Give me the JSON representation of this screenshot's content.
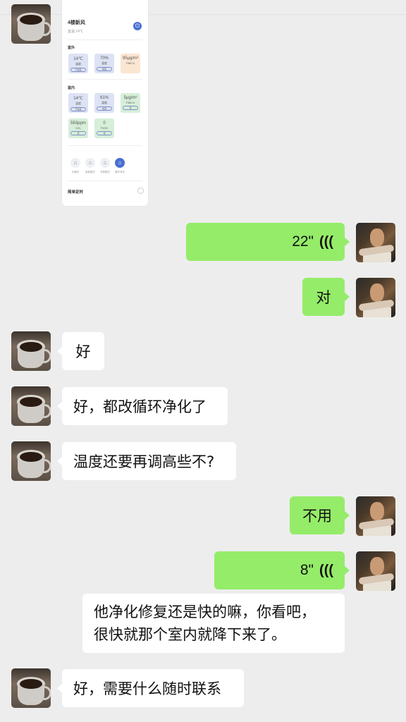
{
  "card": {
    "device_title": "4楼新风",
    "device_sub": "室温 14℃",
    "outdoor_label": "室外",
    "indoor_label": "室内",
    "outdoor_tiles": [
      {
        "value": "14℃",
        "label": "温度",
        "btn": "不适宜"
      },
      {
        "value": "70%",
        "label": "湿度",
        "btn": "适宜"
      },
      {
        "value": "95μg/m³",
        "label": "PM2.5",
        "btn": ""
      }
    ],
    "indoor_tiles": [
      {
        "value": "14℃",
        "label": "温度",
        "btn": "不适宜"
      },
      {
        "value": "61%",
        "label": "湿度",
        "btn": "适宜"
      },
      {
        "value": "5μg/m³",
        "label": "PM2.5",
        "btn": "优"
      },
      {
        "value": "563ppm",
        "label": "CO₂",
        "btn": "优"
      },
      {
        "value": "0",
        "label": "TVOC",
        "btn": "优"
      }
    ],
    "modes": [
      "外循环",
      "智能模式",
      "节能模式",
      "循环净化"
    ],
    "timer_label": "简单定时"
  },
  "messages": [
    {
      "side": "right",
      "type": "voice",
      "duration": "22\""
    },
    {
      "side": "right",
      "type": "text",
      "text": "对"
    },
    {
      "side": "left",
      "type": "text",
      "text": "好"
    },
    {
      "side": "left",
      "type": "text",
      "text": "好，都改循环净化了"
    },
    {
      "side": "left",
      "type": "text",
      "text": "温度还要再调高些不?"
    },
    {
      "side": "right",
      "type": "text",
      "text": "不用"
    },
    {
      "side": "right",
      "type": "voice",
      "duration": "8\""
    },
    {
      "side": "center",
      "type": "text",
      "text": "他净化修复还是快的嘛，你看吧，\n很快就那个室内就降下来了。"
    },
    {
      "side": "left",
      "type": "text",
      "text": "好，需要什么随时联系"
    }
  ],
  "colors": {
    "bg": "#ededed",
    "green_bubble": "#95ec69",
    "white_bubble": "#ffffff"
  }
}
